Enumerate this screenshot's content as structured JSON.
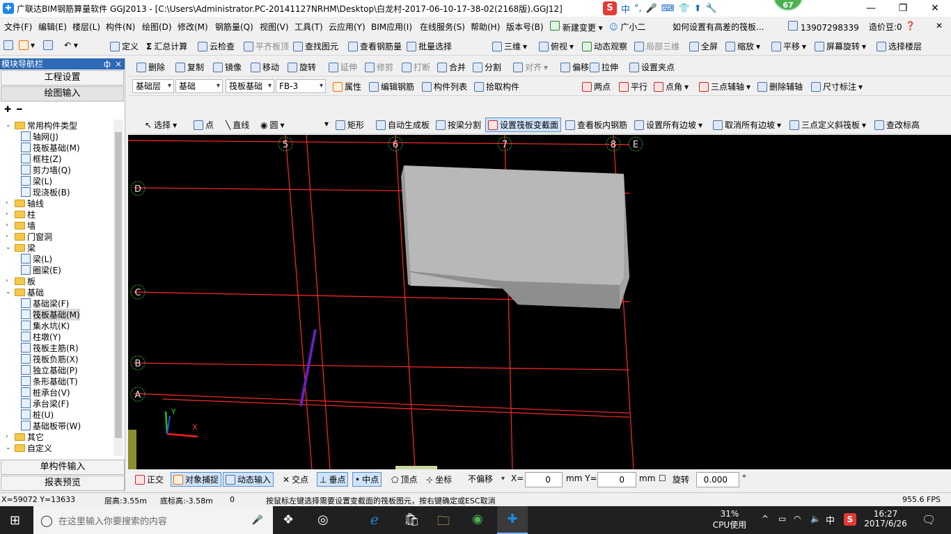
{
  "window": {
    "title": "广联达BIM钢筋算量软件 GGJ2013 - [C:\\Users\\Administrator.PC-20141127NRHM\\Desktop\\白龙村-2017-06-10-17-38-02(2168版).GGJ12]",
    "badge": "67",
    "ime": [
      "中",
      "°,",
      "🎤",
      "⌨",
      "👕",
      "⬆",
      "🔧"
    ]
  },
  "menu": [
    "文件(F)",
    "编辑(E)",
    "楼层(L)",
    "构件(N)",
    "绘图(D)",
    "修改(M)",
    "钢筋量(Q)",
    "视图(V)",
    "工具(T)",
    "云应用(Y)",
    "BIM应用(I)",
    "在线服务(S)",
    "帮助(H)",
    "版本号(B)",
    "新建变更",
    "广小二"
  ],
  "menu_right": {
    "question": "如何设置有高差的筏板...",
    "phone": "13907298339",
    "beans": "造价豆:0"
  },
  "toolbar1": [
    "定义",
    "汇总计算",
    "云检查",
    "平齐板顶",
    "查找图元",
    "查看钢筋量",
    "批量选择",
    "三维",
    "俯视",
    "动态观察",
    "局部三维",
    "全屏",
    "缩放",
    "平移",
    "屏幕旋转",
    "选择楼层"
  ],
  "toolbar2": [
    "删除",
    "复制",
    "镜像",
    "移动",
    "旋转",
    "延伸",
    "修剪",
    "打断",
    "合并",
    "分割",
    "对齐",
    "偏移",
    "拉伸",
    "设置夹点"
  ],
  "toolbar3": {
    "combos": [
      "基础层",
      "基础",
      "筏板基础",
      "FB-3"
    ],
    "buttons": [
      "属性",
      "编辑钢筋",
      "构件列表",
      "拾取构件"
    ],
    "right": [
      "两点",
      "平行",
      "点角",
      "三点辅轴",
      "删除辅轴",
      "尺寸标注"
    ]
  },
  "toolbar4": [
    "选择",
    "点",
    "直线",
    "圆",
    "矩形",
    "自动生成板",
    "按梁分割",
    "设置筏板变截面",
    "查看板内钢筋",
    "设置所有边坡",
    "取消所有边坡",
    "三点定义斜筏板",
    "查改标高"
  ],
  "sidebar": {
    "header": "模块导航栏",
    "pin": "ф",
    "close": "×",
    "top_buttons": [
      "工程设置",
      "绘图输入"
    ],
    "tree": [
      {
        "label": "常用构件类型",
        "level": 0,
        "type": "folder",
        "open": true
      },
      {
        "label": "轴网(J)",
        "level": 1,
        "type": "leaf"
      },
      {
        "label": "筏板基础(M)",
        "level": 1,
        "type": "leaf"
      },
      {
        "label": "框柱(Z)",
        "level": 1,
        "type": "leaf"
      },
      {
        "label": "剪力墙(Q)",
        "level": 1,
        "type": "leaf"
      },
      {
        "label": "梁(L)",
        "level": 1,
        "type": "leaf"
      },
      {
        "label": "现浇板(B)",
        "level": 1,
        "type": "leaf"
      },
      {
        "label": "轴线",
        "level": 0,
        "type": "folder",
        "open": false
      },
      {
        "label": "柱",
        "level": 0,
        "type": "folder",
        "open": false
      },
      {
        "label": "墙",
        "level": 0,
        "type": "folder",
        "open": false
      },
      {
        "label": "门窗洞",
        "level": 0,
        "type": "folder",
        "open": false
      },
      {
        "label": "梁",
        "level": 0,
        "type": "folder",
        "open": true
      },
      {
        "label": "梁(L)",
        "level": 1,
        "type": "leaf"
      },
      {
        "label": "圈梁(E)",
        "level": 1,
        "type": "leaf"
      },
      {
        "label": "板",
        "level": 0,
        "type": "folder",
        "open": false
      },
      {
        "label": "基础",
        "level": 0,
        "type": "folder",
        "open": true
      },
      {
        "label": "基础梁(F)",
        "level": 1,
        "type": "leaf"
      },
      {
        "label": "筏板基础(M)",
        "level": 1,
        "type": "leaf",
        "selected": true
      },
      {
        "label": "集水坑(K)",
        "level": 1,
        "type": "leaf"
      },
      {
        "label": "柱墩(Y)",
        "level": 1,
        "type": "leaf"
      },
      {
        "label": "筏板主筋(R)",
        "level": 1,
        "type": "leaf"
      },
      {
        "label": "筏板负筋(X)",
        "level": 1,
        "type": "leaf"
      },
      {
        "label": "独立基础(P)",
        "level": 1,
        "type": "leaf"
      },
      {
        "label": "条形基础(T)",
        "level": 1,
        "type": "leaf"
      },
      {
        "label": "桩承台(V)",
        "level": 1,
        "type": "leaf"
      },
      {
        "label": "承台梁(F)",
        "level": 1,
        "type": "leaf"
      },
      {
        "label": "桩(U)",
        "level": 1,
        "type": "leaf"
      },
      {
        "label": "基础板带(W)",
        "level": 1,
        "type": "leaf"
      },
      {
        "label": "其它",
        "level": 0,
        "type": "folder",
        "open": false
      },
      {
        "label": "自定义",
        "level": 0,
        "type": "folder",
        "open": true
      }
    ],
    "bottom_buttons": [
      "单构件输入",
      "报表预览"
    ]
  },
  "canvas": {
    "col_axes": [
      "5",
      "6",
      "7",
      "8",
      "E"
    ],
    "row_axes": [
      "D",
      "C",
      "B",
      "A"
    ]
  },
  "snapbar": {
    "items": [
      "正交",
      "对象捕捉",
      "动态输入",
      "交点",
      "垂点",
      "中点",
      "顶点",
      "坐标"
    ],
    "offset": "不偏移",
    "x_label": "X=",
    "x_value": "0",
    "y_label": "mm Y=",
    "y_value": "0",
    "unit": "mm",
    "rotate_label": "旋转",
    "rotate_value": "0.000",
    "degree": "°"
  },
  "status": {
    "coords": "X=59072 Y=13633",
    "floor_height": "层高:3.55m",
    "base_height": "底标高:-3.58m",
    "zero": "0",
    "hint": "按鼠标左键选择需要设置变截面的筏板图元，按右键确定或ESC取消",
    "fps": "955.6 FPS"
  },
  "taskbar": {
    "search_placeholder": "在这里输入你要搜索的内容",
    "cpu_percent": "31%",
    "cpu_label": "CPU使用",
    "ime": "中",
    "time": "16:27",
    "date": "2017/6/26"
  },
  "colors": {
    "accent": "#2d69b5",
    "grid_line": "#ff2a2a",
    "axis_circle": "#2db82d",
    "slab": "#c8c8c8",
    "purple_line": "#6a1fb8"
  }
}
